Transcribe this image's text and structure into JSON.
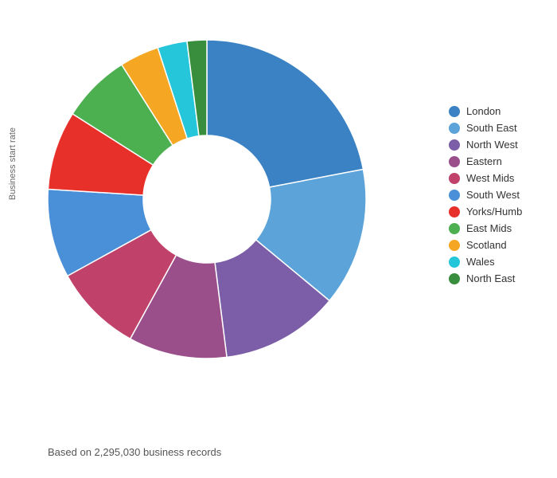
{
  "legend": {
    "items": [
      {
        "label": "London",
        "color": "#3B82C4"
      },
      {
        "label": "South East",
        "color": "#5BA3D9"
      },
      {
        "label": "North West",
        "color": "#7B5EA7"
      },
      {
        "label": "Eastern",
        "color": "#9B4F8A"
      },
      {
        "label": "West Mids",
        "color": "#C0426B"
      },
      {
        "label": "South West",
        "color": "#4A90D9"
      },
      {
        "label": "Yorks/Humb",
        "color": "#E8302A"
      },
      {
        "label": "East Mids",
        "color": "#4CAF50"
      },
      {
        "label": "Scotland",
        "color": "#F5A623"
      },
      {
        "label": "Wales",
        "color": "#26C6DA"
      },
      {
        "label": "North East",
        "color": "#388E3C"
      }
    ]
  },
  "footer": {
    "text": "Based on 2,295,030 business records"
  },
  "y_axis_label": "Business start rate",
  "chart": {
    "segments": [
      {
        "label": "London",
        "color": "#3B82C4",
        "value": 22
      },
      {
        "label": "South East",
        "color": "#5BA3D9",
        "value": 14
      },
      {
        "label": "North West",
        "color": "#7B5EA7",
        "value": 12
      },
      {
        "label": "Eastern",
        "color": "#9B4F8A",
        "value": 10
      },
      {
        "label": "West Mids",
        "color": "#C0426B",
        "value": 9
      },
      {
        "label": "South West",
        "color": "#4A90D9",
        "value": 9
      },
      {
        "label": "Yorks/Humb",
        "color": "#E8302A",
        "value": 8
      },
      {
        "label": "East Mids",
        "color": "#4CAF50",
        "value": 7
      },
      {
        "label": "Scotland",
        "color": "#F5A623",
        "value": 4
      },
      {
        "label": "Wales",
        "color": "#26C6DA",
        "value": 3
      },
      {
        "label": "North East",
        "color": "#388E3C",
        "value": 2
      }
    ]
  }
}
